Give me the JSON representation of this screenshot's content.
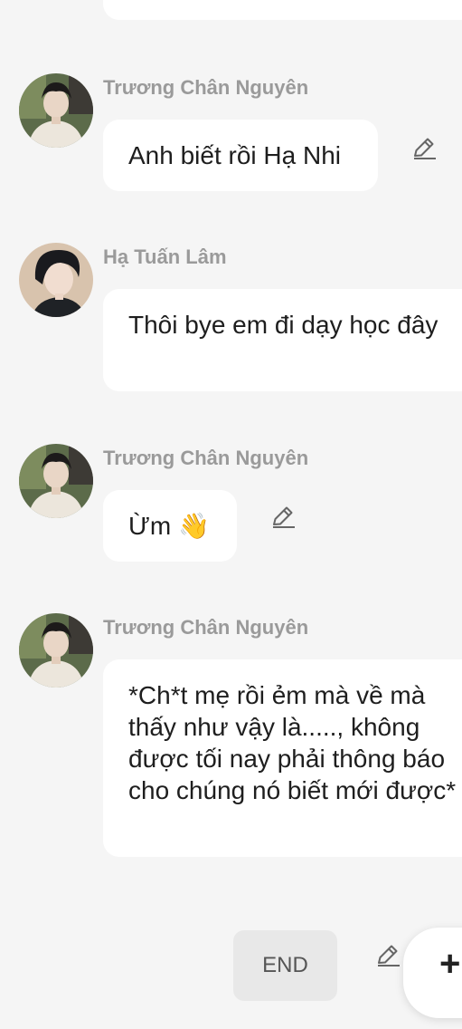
{
  "messages": [
    {
      "sender": "Trương Chân Nguyên",
      "text": "Anh biết rồi Hạ Nhi",
      "avatar": "avatar-truong-chan-nguyen",
      "editable": true
    },
    {
      "sender": "Hạ Tuấn Lâm",
      "text": "Thôi bye em đi dạy học đây",
      "avatar": "avatar-ha-tuan-lam",
      "editable": false
    },
    {
      "sender": "Trương Chân Nguyên",
      "text": "Ừm 👋",
      "avatar": "avatar-truong-chan-nguyen",
      "editable": true
    },
    {
      "sender": "Trương Chân Nguyên",
      "text": "*Ch*t mẹ rồi ẻm mà về mà thấy như vậy là....., không được tối nay phải thông báo cho chúng nó biết mới được*",
      "avatar": "avatar-truong-chan-nguyen",
      "editable": false
    }
  ],
  "footer": {
    "end_label": "END",
    "add_symbol": "+"
  },
  "colors": {
    "background": "#f5f5f5",
    "bubble": "#ffffff",
    "sender_text": "#9a9a9a",
    "message_text": "#1e1e1e"
  }
}
